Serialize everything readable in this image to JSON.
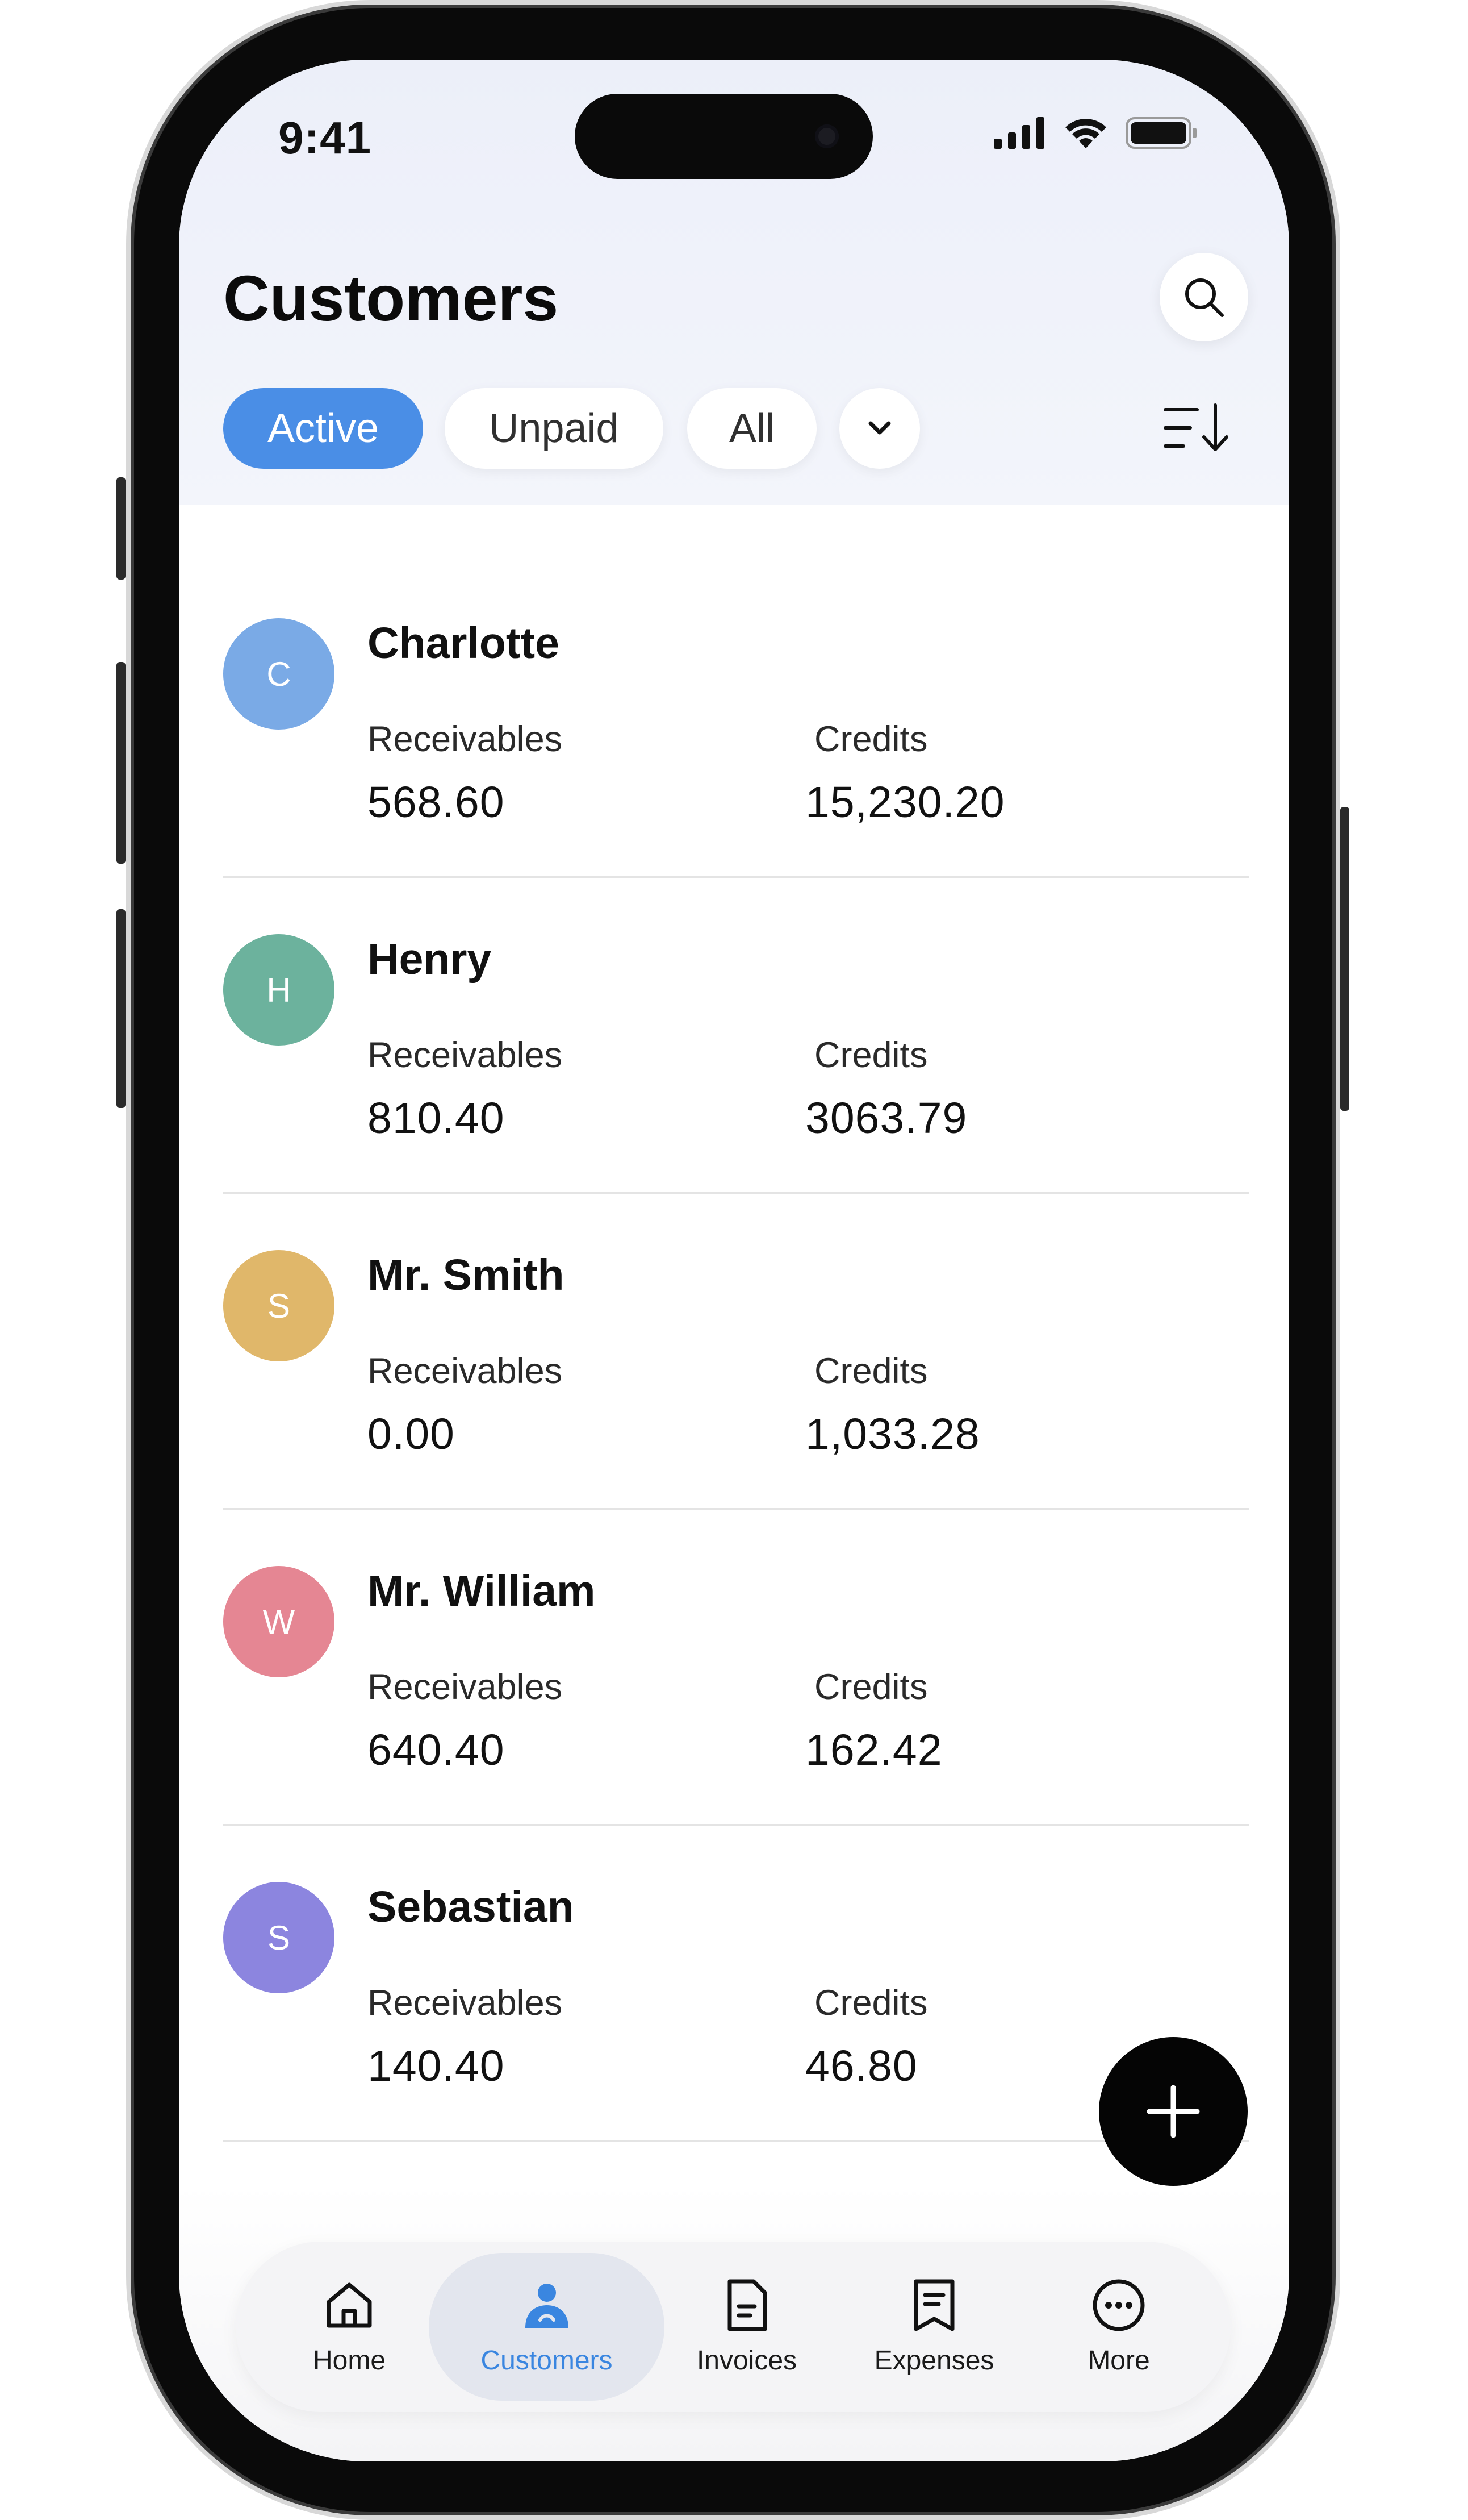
{
  "status_bar": {
    "time": "9:41"
  },
  "header": {
    "title": "Customers",
    "filters": [
      {
        "label": "Active",
        "selected": true
      },
      {
        "label": "Unpaid",
        "selected": false
      },
      {
        "label": "All",
        "selected": false
      }
    ]
  },
  "colors": {
    "accent": "#4a8ee6",
    "fab": "#050505"
  },
  "customers": [
    {
      "initial": "C",
      "name": "Charlotte",
      "receivables_label": "Receivables",
      "receivables": "568.60",
      "credits_label": "Credits",
      "credits": "15,230.20",
      "color": "#7aaae6"
    },
    {
      "initial": "H",
      "name": "Henry",
      "receivables_label": "Receivables",
      "receivables": "810.40",
      "credits_label": "Credits",
      "credits": "3063.79",
      "color": "#6cb29d"
    },
    {
      "initial": "S",
      "name": "Mr. Smith",
      "receivables_label": "Receivables",
      "receivables": "0.00",
      "credits_label": "Credits",
      "credits": "1,033.28",
      "color": "#e0b76a"
    },
    {
      "initial": "W",
      "name": "Mr. William",
      "receivables_label": "Receivables",
      "receivables": "640.40",
      "credits_label": "Credits",
      "credits": "162.42",
      "color": "#e58693"
    },
    {
      "initial": "S",
      "name": "Sebastian",
      "receivables_label": "Receivables",
      "receivables": "140.40",
      "credits_label": "Credits",
      "credits": "46.80",
      "color": "#8c85df"
    }
  ],
  "tabbar": {
    "items": [
      {
        "label": "Home",
        "icon": "home-icon"
      },
      {
        "label": "Customers",
        "icon": "person-icon",
        "active": true
      },
      {
        "label": "Invoices",
        "icon": "document-icon"
      },
      {
        "label": "Expenses",
        "icon": "receipt-icon"
      },
      {
        "label": "More",
        "icon": "more-icon"
      }
    ]
  }
}
